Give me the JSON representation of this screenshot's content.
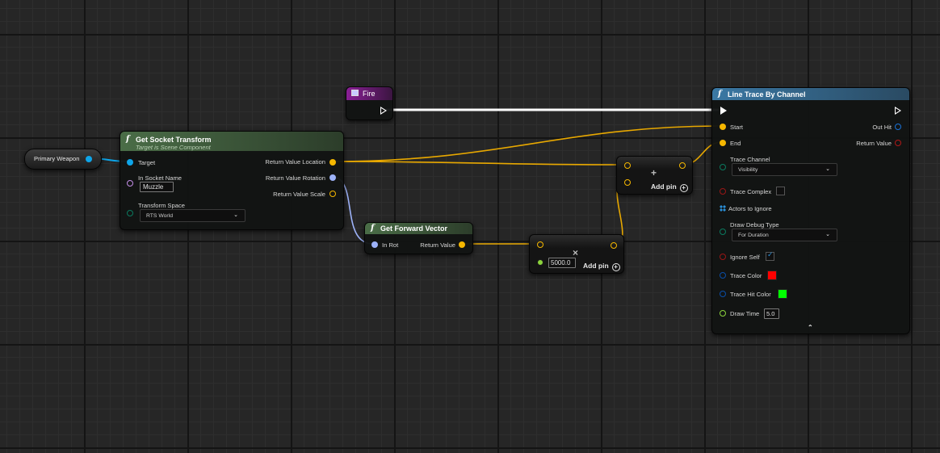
{
  "nodes": {
    "primary_weapon": {
      "label": "Primary Weapon"
    },
    "fire": {
      "title": "Fire"
    },
    "get_socket_transform": {
      "title": "Get Socket Transform",
      "subtitle": "Target is Scene Component",
      "pin_target": "Target",
      "pin_socket_name": "In Socket Name",
      "socket_name_value": "Muzzle",
      "pin_transform_space": "Transform Space",
      "transform_space_value": "RTS World",
      "out_location": "Return Value Location",
      "out_rotation": "Return Value Rotation",
      "out_scale": "Return Value Scale"
    },
    "get_forward_vector": {
      "title": "Get Forward Vector",
      "pin_in_rot": "In Rot",
      "out_return": "Return Value"
    },
    "multiply": {
      "symbol": "×",
      "value": "5000.0",
      "add_pin": "Add pin"
    },
    "add": {
      "symbol": "+",
      "add_pin": "Add pin"
    },
    "line_trace": {
      "title": "Line Trace By Channel",
      "pin_start": "Start",
      "pin_end": "End",
      "out_hit": "Out Hit",
      "out_return": "Return Value",
      "pin_trace_channel": "Trace Channel",
      "trace_channel_value": "Visibility",
      "pin_trace_complex": "Trace Complex",
      "pin_actors_ignore": "Actors to Ignore",
      "pin_draw_debug": "Draw Debug Type",
      "draw_debug_value": "For Duration",
      "pin_ignore_self": "Ignore Self",
      "ignore_self_checked": true,
      "pin_trace_color": "Trace Color",
      "trace_color": "#ff0000",
      "pin_trace_hit_color": "Trace Hit Color",
      "trace_hit_color": "#00ff00",
      "pin_draw_time": "Draw Time",
      "draw_time_value": "5.0",
      "collapse_icon": "chevron-up-icon"
    }
  },
  "colors": {
    "vector_pin": "#f5b700",
    "object_pin": "#0ea5e9",
    "rotator_pin": "#9db2f8",
    "name_pin": "#c48ee8",
    "enum_pin": "#0b7a5f",
    "bool_pin": "#9a1616",
    "struct_pin": "#0b4ea8",
    "float_pin": "#8cd43c",
    "function_header": "#3f5c3c",
    "line_trace_header": "#2e5f84",
    "event_header": "#7d1f86"
  }
}
